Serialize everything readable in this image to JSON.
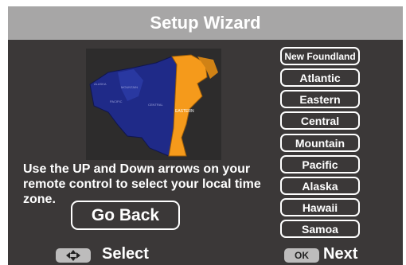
{
  "title": "Setup Wizard",
  "map": {
    "icon": "north-america-time-zone-map",
    "labels": [
      "EASTERN",
      "CENTRAL",
      "ALASKA",
      "PACIFIC",
      "MOUNTAIN"
    ]
  },
  "instructions": "Use the UP and Down arrows on your remote control  to select your local time zone.",
  "go_back_label": "Go Back",
  "timezones": [
    "New Foundland",
    "Atlantic",
    "Eastern",
    "Central",
    "Mountain",
    "Pacific",
    "Alaska",
    "Hawaii",
    "Samoa"
  ],
  "footer": {
    "select_icon": "dpad-arrows-icon",
    "select_label": "Select",
    "next_key": "OK",
    "next_label": "Next"
  },
  "colors": {
    "background": "#3b3838",
    "titlebar": "#a7a6a6",
    "map_highlight": "#f59a1b",
    "map_base": "#1f2a88"
  }
}
